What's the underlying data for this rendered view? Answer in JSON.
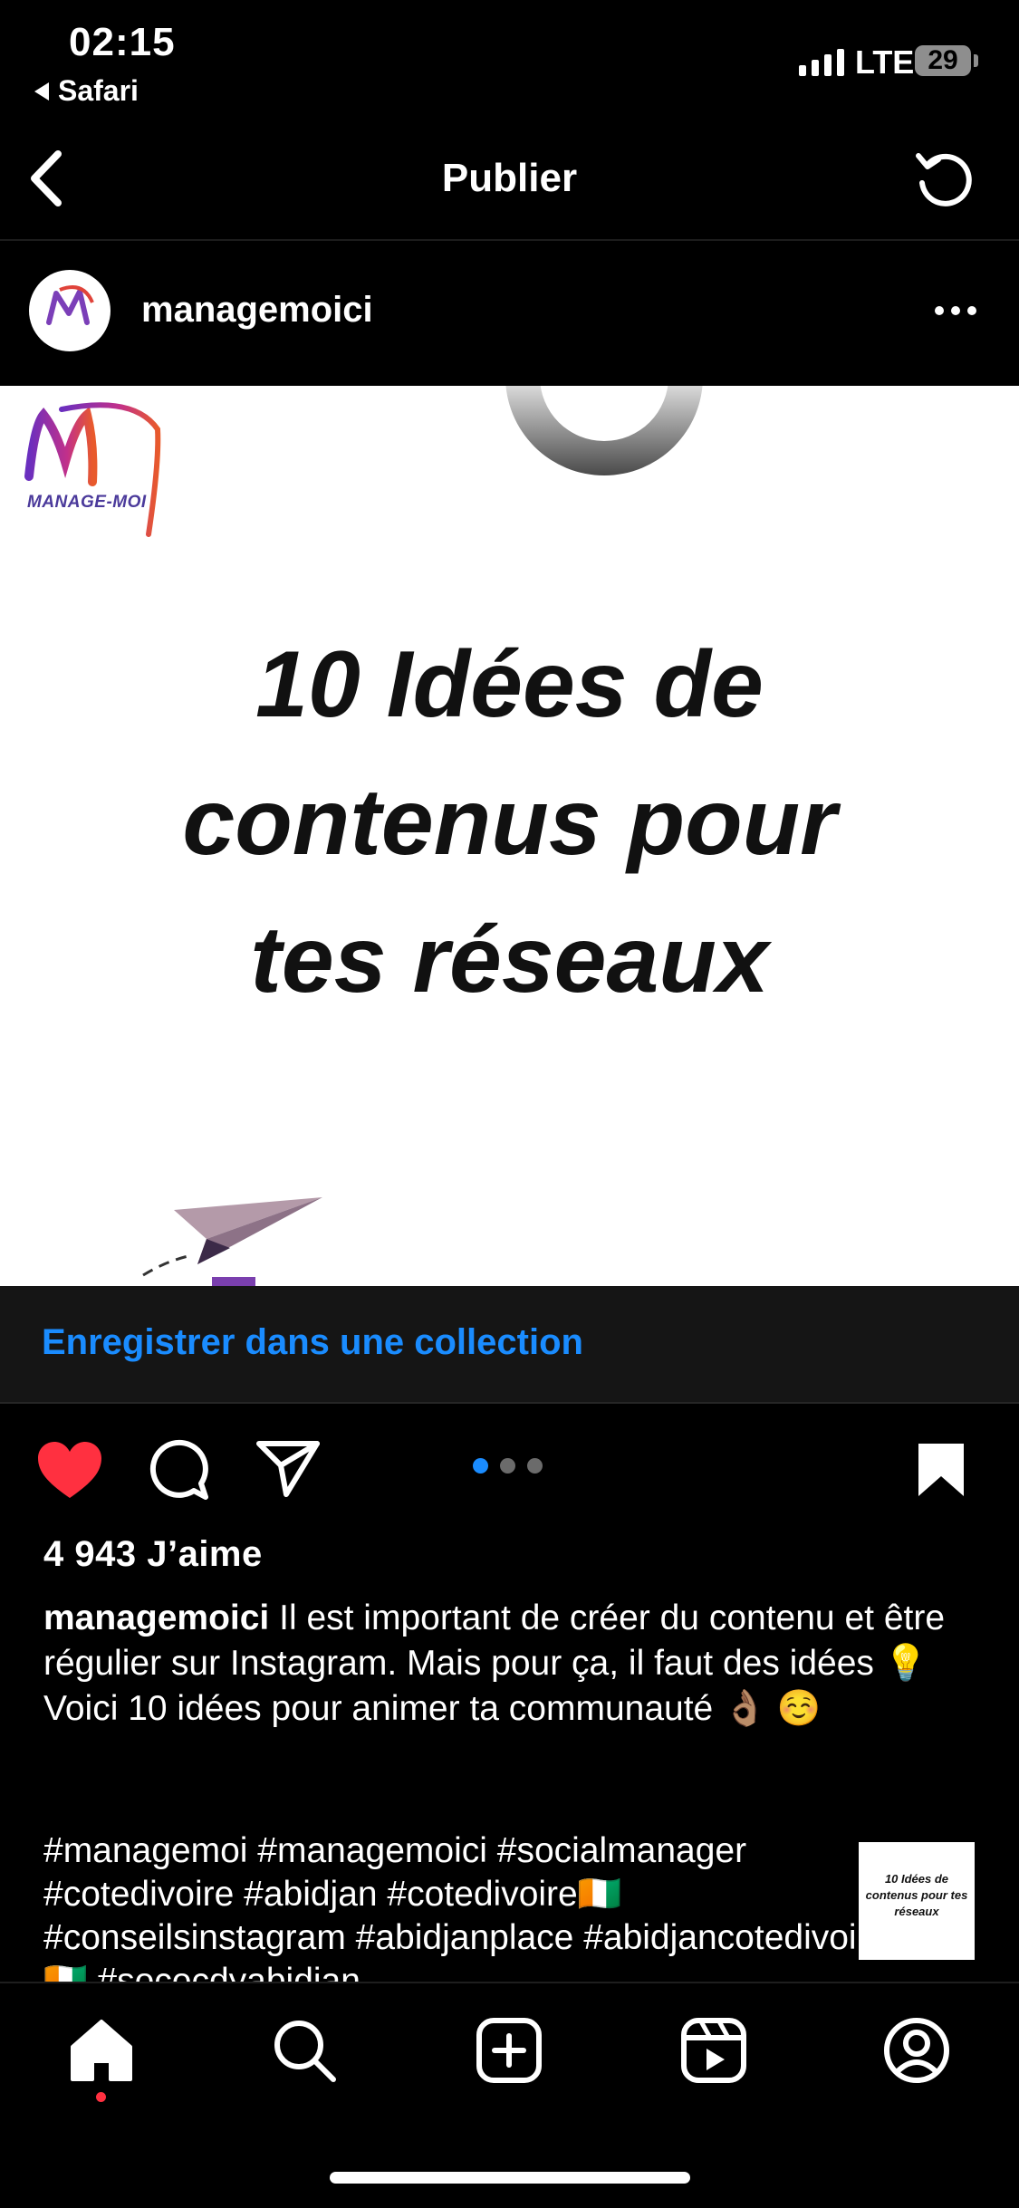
{
  "status_bar": {
    "time": "02:15",
    "back_app": "Safari",
    "network": "LTE",
    "battery": "29"
  },
  "nav": {
    "title": "Publier",
    "back_icon": "chevron-left-icon",
    "refresh_icon": "refresh-icon"
  },
  "post": {
    "username": "managemoici",
    "image": {
      "brand": "MANAGE-MOI",
      "title_lines": [
        "10 Idées de",
        "contenus pour",
        "tes réseaux"
      ]
    },
    "save_to_collection": "Enregistrer dans une collection",
    "likes": "4 943 J’aime",
    "caption_username": "managemoici",
    "caption_text": "Il est important de créer du contenu et être régulier sur Instagram. Mais pour ça, il faut des idées 💡",
    "caption_line2": "Voici 10 idées pour animer ta communauté 👌🏽 ☺️",
    "hashtags": "#managemoi #managemoici #socialmanager #cotedivoire #abidjan #cotedivoire🇨🇮 #conseilsinstagram #abidjanplace #abidjancotedivoire🇨🇮 #sococdyabidjan",
    "thumbnail_text": "10 Idées de contenus pour tes réseaux",
    "carousel": {
      "count": 3,
      "active": 1
    }
  },
  "tab_bar": {
    "items": [
      "home-icon",
      "search-icon",
      "create-icon",
      "reels-icon",
      "profile-icon"
    ],
    "active": "home-icon"
  },
  "colors": {
    "accent": "#1a8cff",
    "like": "#ff3040",
    "background": "#000000"
  }
}
